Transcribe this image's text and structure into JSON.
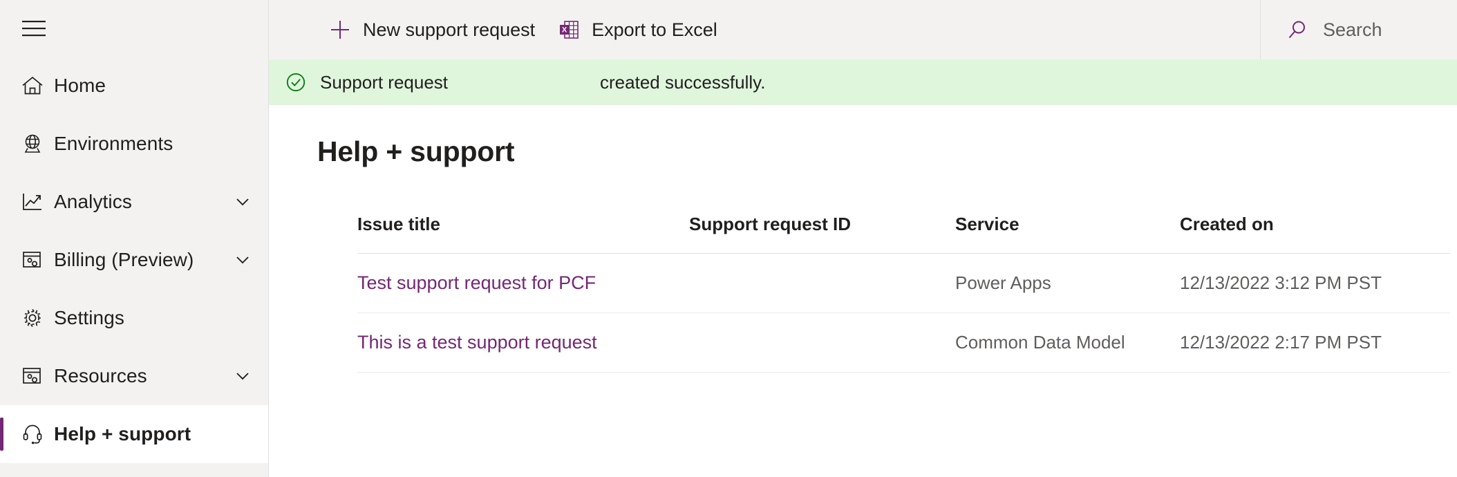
{
  "sidebar": {
    "menu_button": {
      "icon": "hamburger-menu-icon",
      "label": "Menu"
    },
    "items": [
      {
        "label": "Home",
        "icon": "home-icon",
        "chevron": false,
        "selected": false
      },
      {
        "label": "Environments",
        "icon": "globe-icon",
        "chevron": false,
        "selected": false
      },
      {
        "label": "Analytics",
        "icon": "line-chart-icon",
        "chevron": true,
        "selected": false
      },
      {
        "label": "Billing (Preview)",
        "icon": "billing-icon",
        "chevron": true,
        "selected": false
      },
      {
        "label": "Settings",
        "icon": "gear-icon",
        "chevron": false,
        "selected": false
      },
      {
        "label": "Resources",
        "icon": "resources-icon",
        "chevron": true,
        "selected": false
      },
      {
        "label": "Help + support",
        "icon": "headset-icon",
        "chevron": false,
        "selected": true
      }
    ]
  },
  "commandbar": {
    "new_request_label": "New support request",
    "new_request_icon": "plus-icon",
    "export_label": "Export to Excel",
    "export_icon": "excel-icon"
  },
  "search": {
    "icon": "search-icon",
    "placeholder": "Search"
  },
  "message_bar": {
    "icon": "checkmark-circle-icon",
    "prefix": "Support request",
    "request_id": "",
    "suffix": "created successfully.",
    "background_color": "#dff6dd",
    "icon_color": "#107c10"
  },
  "page": {
    "title": "Help + support"
  },
  "table": {
    "columns": [
      "Issue title",
      "Support request ID",
      "Service",
      "Created on"
    ],
    "rows": [
      {
        "issue_title": "Test support request for PCF",
        "support_request_id": "",
        "service": "Power Apps",
        "created_on": "12/13/2022 3:12 PM PST"
      },
      {
        "issue_title": "This is a test support request",
        "support_request_id": "",
        "service": "Common Data Model",
        "created_on": "12/13/2022 2:17 PM PST"
      }
    ]
  },
  "colors": {
    "accent_purple": "#742774",
    "link_purple": "#742774",
    "sidebar_bg": "#f3f2f1",
    "success_green": "#107c10",
    "success_bg": "#dff6dd"
  }
}
